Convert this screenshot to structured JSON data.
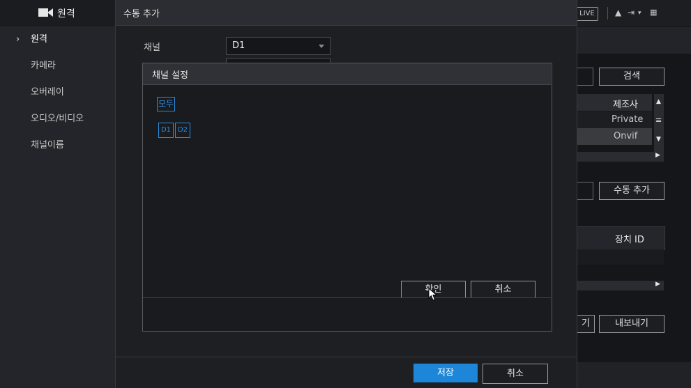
{
  "sidebar": {
    "header_title": "원격",
    "items": [
      {
        "label": "원격",
        "active": true
      },
      {
        "label": "카메라",
        "active": false
      },
      {
        "label": "오버레이",
        "active": false
      },
      {
        "label": "오디오/비디오",
        "active": false
      },
      {
        "label": "채널이름",
        "active": false
      }
    ]
  },
  "topbar": {
    "live_label": "LIVE"
  },
  "background": {
    "search_label": "검색",
    "col_manufacturer": "제조사",
    "row1": "Private",
    "row2": "Onvif",
    "manual_add_label": "수동 추가",
    "col_device_id": "장치 ID",
    "import_partial": "기",
    "export_label": "내보내기"
  },
  "manual_add_dialog": {
    "title": "수동 추가",
    "channel_label": "채널",
    "channel_value": "D1",
    "save_label": "저장",
    "cancel_label": "취소"
  },
  "channel_dialog": {
    "title": "채널 설정",
    "all_label": "모두",
    "channels": [
      "D1",
      "D2"
    ],
    "ok_label": "확인",
    "cancel_label": "취소"
  },
  "colors": {
    "accent": "#1d86d9",
    "sidebar_bg": "#23252a",
    "dialog_bg": "#1e1f23"
  }
}
